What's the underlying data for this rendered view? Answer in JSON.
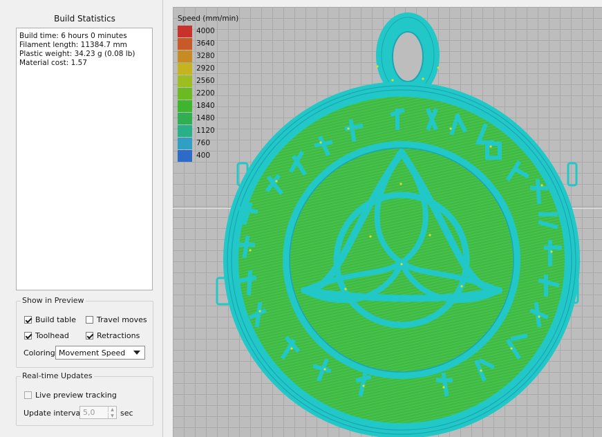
{
  "stats": {
    "title": "Build Statistics",
    "lines": [
      "Build time: 6 hours 0 minutes",
      "Filament length: 11384.7 mm",
      "Plastic weight: 34.23 g (0.08 lb)",
      "Material cost: 1.57"
    ]
  },
  "show_preview": {
    "title": "Show in Preview",
    "build_table": {
      "label": "Build table",
      "checked": true
    },
    "travel_moves": {
      "label": "Travel moves",
      "checked": false
    },
    "toolhead": {
      "label": "Toolhead",
      "checked": true
    },
    "retractions": {
      "label": "Retractions",
      "checked": true
    },
    "coloring_label": "Coloring",
    "coloring_value": "Movement Speed"
  },
  "realtime": {
    "title": "Real-time Updates",
    "live_preview": {
      "label": "Live preview tracking",
      "checked": false
    },
    "interval_label": "Update interval",
    "interval_value": "5,0",
    "interval_unit": "sec"
  },
  "legend": {
    "title": "Speed (mm/min)",
    "items": [
      {
        "value": "4000",
        "color": "#c8322a"
      },
      {
        "value": "3640",
        "color": "#c75a26"
      },
      {
        "value": "3280",
        "color": "#c88a22"
      },
      {
        "value": "2920",
        "color": "#c4b51f"
      },
      {
        "value": "2560",
        "color": "#9dbd20"
      },
      {
        "value": "2200",
        "color": "#6cba22"
      },
      {
        "value": "1840",
        "color": "#3fb52e"
      },
      {
        "value": "1480",
        "color": "#2fae52"
      },
      {
        "value": "1120",
        "color": "#2ab087"
      },
      {
        "value": "760",
        "color": "#2f9fc4"
      },
      {
        "value": "400",
        "color": "#2d6bc9"
      }
    ]
  },
  "colors": {
    "perimeter": "#22c7c7",
    "infill": "#3fbb44",
    "retraction": "#d8e02a"
  }
}
